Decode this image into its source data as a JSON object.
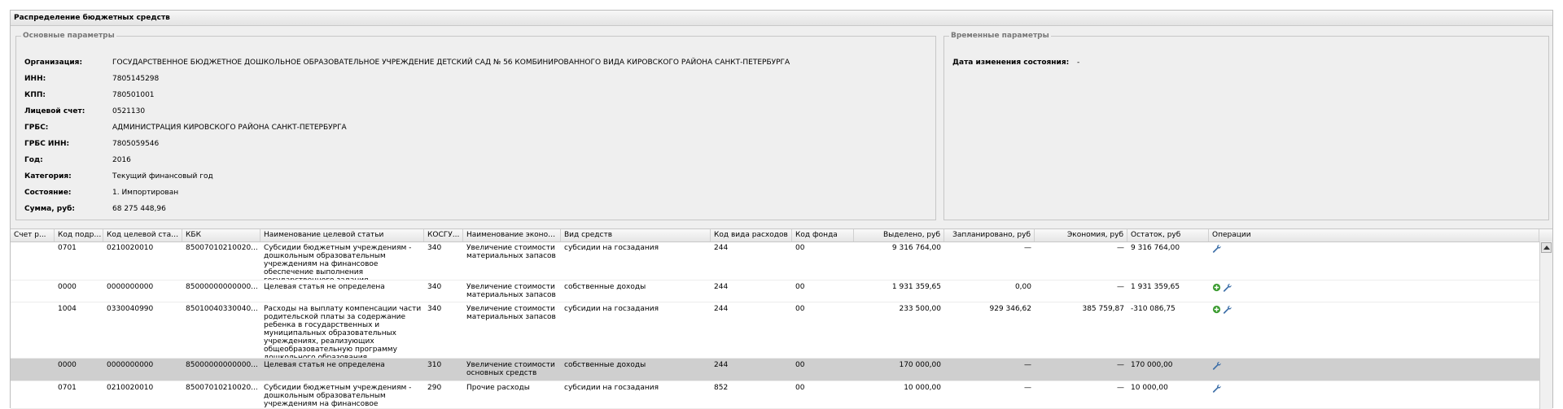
{
  "panel": {
    "title": "Распределение бюджетных средств"
  },
  "main_params": {
    "legend": "Основные параметры",
    "fields": [
      {
        "label": "Организация:",
        "value": "ГОСУДАРСТВЕННОЕ БЮДЖЕТНОЕ ДОШКОЛЬНОЕ ОБРАЗОВАТЕЛЬНОЕ УЧРЕЖДЕНИЕ ДЕТСКИЙ САД № 56 КОМБИНИРОВАННОГО ВИДА КИРОВСКОГО РАЙОНА САНКТ-ПЕТЕРБУРГА"
      },
      {
        "label": "ИНН:",
        "value": "7805145298"
      },
      {
        "label": "КПП:",
        "value": "780501001"
      },
      {
        "label": "Лицевой счет:",
        "value": "0521130"
      },
      {
        "label": "ГРБС:",
        "value": "АДМИНИСТРАЦИЯ КИРОВСКОГО РАЙОНА САНКТ-ПЕТЕРБУРГА"
      },
      {
        "label": "ГРБС ИНН:",
        "value": "7805059546"
      },
      {
        "label": "Год:",
        "value": "2016"
      },
      {
        "label": "Категория:",
        "value": "Текущий финансовый год"
      },
      {
        "label": "Состояние:",
        "value": "1. Импортирован"
      },
      {
        "label": "Сумма, руб:",
        "value": "68 275 448,96"
      }
    ]
  },
  "time_params": {
    "legend": "Временные параметры",
    "fields": [
      {
        "label": "Дата изменения состояния:",
        "value": "-"
      }
    ]
  },
  "grid": {
    "columns": [
      "Счет р...",
      "Код подра...",
      "Код целевой статьи",
      "КБК",
      "Наименование целевой статьи",
      "КОСГУ...",
      "Наименование экономической ...",
      "Вид средств",
      "Код вида расходов",
      "Код фонда",
      "Выделено, руб",
      "Запланировано, руб",
      "Экономия, руб",
      "Остаток, руб",
      "Операции"
    ],
    "rows": [
      {
        "c0": "",
        "c1": "0701",
        "c2": "0210020010",
        "c3": "85007010210020...",
        "c4": "Субсидии бюджетным учреждениям - дошкольным образовательным учреждениям на финансовое обеспечение выполнения государственного задания",
        "c5": "340",
        "c6": "Увеличение стоимости материальных запасов",
        "c7": "субсидии на госзадания",
        "c8": "244",
        "c9": "00",
        "c10": "9 316 764,00",
        "c11": "—",
        "c12": "—",
        "c13": "9 316 764,00",
        "ops": [
          "wrench-icon"
        ]
      },
      {
        "c0": "",
        "c1": "0000",
        "c2": "0000000000",
        "c3": "85000000000000...",
        "c4": "Целевая статья не определена",
        "c5": "340",
        "c6": "Увеличение стоимости материальных запасов",
        "c7": "собственные доходы",
        "c8": "244",
        "c9": "00",
        "c10": "1 931 359,65",
        "c11": "0,00",
        "c12": "—",
        "c13": "1 931 359,65",
        "ops": [
          "add-icon",
          "wrench-icon"
        ]
      },
      {
        "c0": "",
        "c1": "1004",
        "c2": "0330040990",
        "c3": "85010040330040...",
        "c4": "Расходы на выплату компенсации части родительской платы за содержание ребенка в государственных и муниципальных образовательных учреждениях, реализующих общеобразовательную программу дошкольного образования",
        "c5": "340",
        "c6": "Увеличение стоимости материальных запасов",
        "c7": "субсидии на госзадания",
        "c8": "244",
        "c9": "00",
        "c10": "233 500,00",
        "c11": "929 346,62",
        "c12": "385 759,87",
        "c13": "-310 086,75",
        "ops": [
          "add-icon",
          "wrench-icon"
        ]
      },
      {
        "c0": "",
        "c1": "0000",
        "c2": "0000000000",
        "c3": "85000000000000...",
        "c4": "Целевая статья не определена",
        "c5": "310",
        "c6": "Увеличение стоимости основных средств",
        "c7": "собственные доходы",
        "c8": "244",
        "c9": "00",
        "c10": "170 000,00",
        "c11": "—",
        "c12": "—",
        "c13": "170 000,00",
        "ops": [
          "wrench-icon"
        ]
      },
      {
        "c0": "",
        "c1": "0701",
        "c2": "0210020010",
        "c3": "85007010210020...",
        "c4": "Субсидии бюджетным учреждениям - дошкольным образовательным учреждениям на финансовое обеспечение выполнения",
        "c5": "290",
        "c6": "Прочие расходы",
        "c7": "субсидии на госзадания",
        "c8": "852",
        "c9": "00",
        "c10": "10 000,00",
        "c11": "—",
        "c12": "—",
        "c13": "10 000,00",
        "ops": [
          "wrench-icon"
        ]
      }
    ]
  },
  "colors": {
    "selected_row": "#cfcfcf",
    "add_icon": "#3a9b2f",
    "wrench_icon": "#3d6fa8"
  }
}
